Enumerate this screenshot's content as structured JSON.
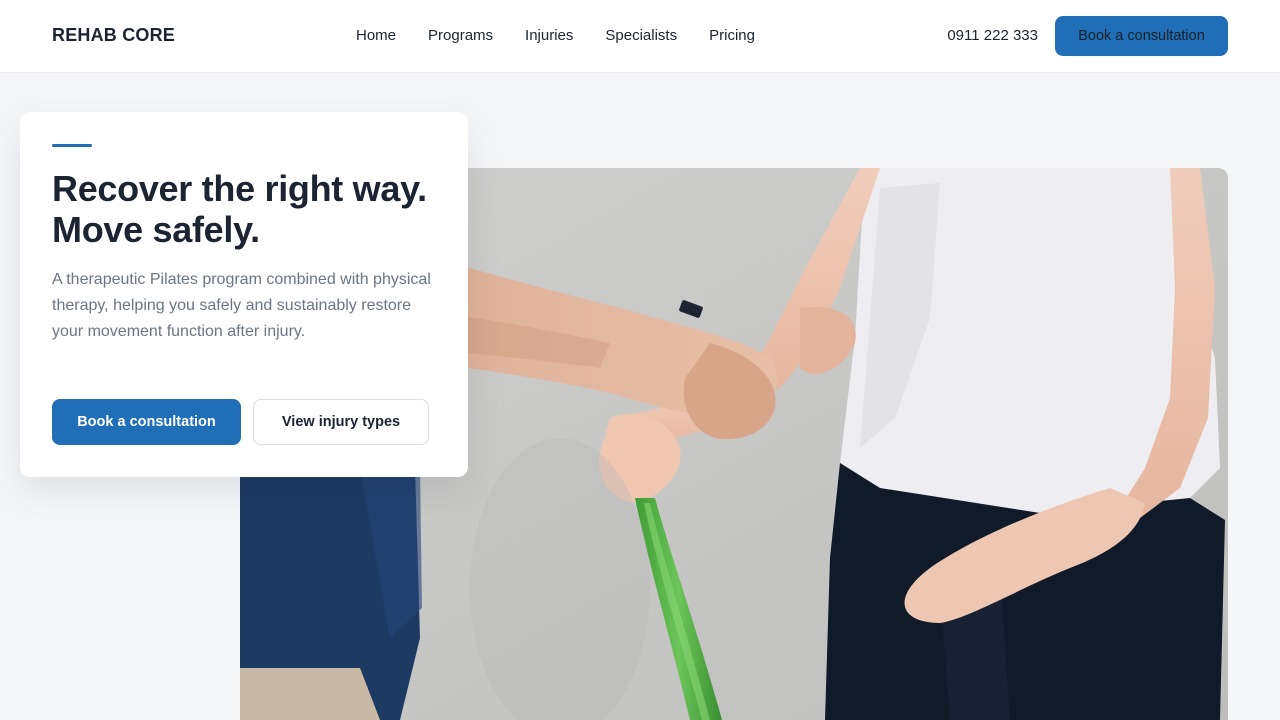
{
  "brand": {
    "name": "REHAB CORE"
  },
  "nav": {
    "items": [
      {
        "label": "Home"
      },
      {
        "label": "Programs"
      },
      {
        "label": "Injuries"
      },
      {
        "label": "Specialists"
      },
      {
        "label": "Pricing"
      }
    ]
  },
  "header": {
    "phone": "0911 222 333",
    "cta_label": "Book a consultation"
  },
  "hero": {
    "headline": "Recover the right way. Move safely.",
    "subtext": "A therapeutic Pilates program combined with physical therapy, helping you safely and sustainably restore your movement function after injury.",
    "primary_cta": "Book a consultation",
    "secondary_cta": "View injury types"
  },
  "colors": {
    "accent": "#1f6eb6",
    "page_background": "#f5f6f8",
    "card_background": "#ffffff",
    "heading_text": "#1b2430",
    "body_text": "#6b7583"
  }
}
